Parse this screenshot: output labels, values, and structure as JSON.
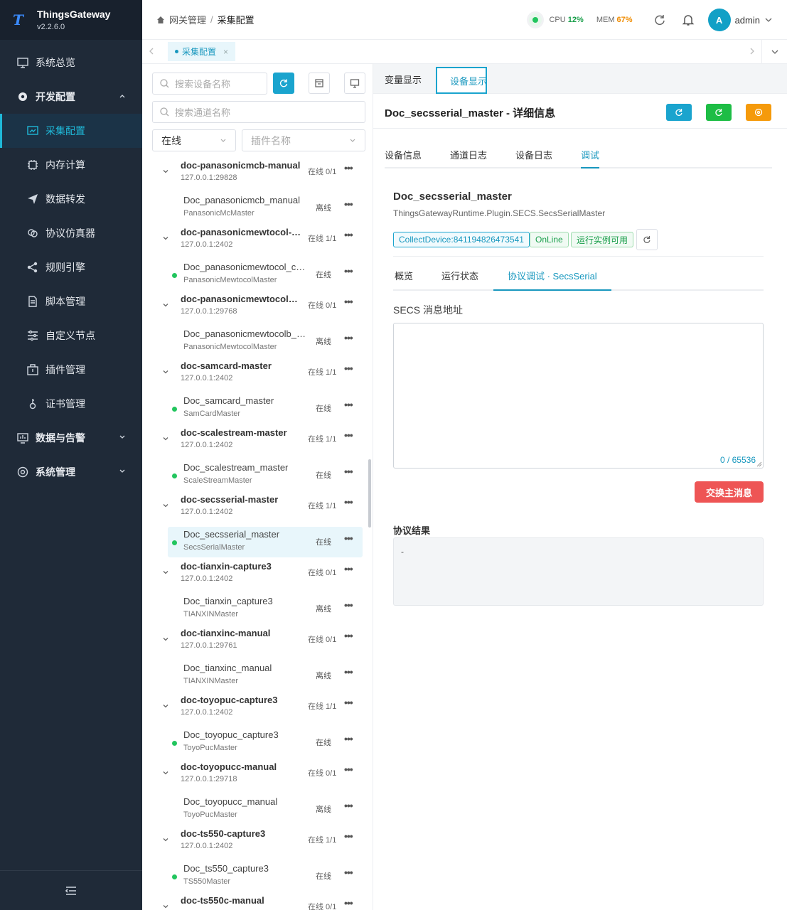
{
  "app": {
    "name": "ThingsGateway",
    "version": "v2.2.6.0"
  },
  "sidebar": {
    "items": [
      {
        "label": "系统总览"
      },
      {
        "label": "开发配置"
      },
      {
        "label": "采集配置"
      },
      {
        "label": "内存计算"
      },
      {
        "label": "数据转发"
      },
      {
        "label": "协议仿真器"
      },
      {
        "label": "规则引擎"
      },
      {
        "label": "脚本管理"
      },
      {
        "label": "自定义节点"
      },
      {
        "label": "插件管理"
      },
      {
        "label": "证书管理"
      },
      {
        "label": "数据与告警"
      },
      {
        "label": "系统管理"
      }
    ]
  },
  "header": {
    "breadcrumb": [
      "网关管理",
      "采集配置"
    ],
    "cpu_label": "CPU",
    "cpu_value": "12%",
    "mem_label": "MEM",
    "mem_value": "67%",
    "avatar_letter": "A",
    "user": "admin"
  },
  "page_tab": {
    "label": "采集配置",
    "close": "×"
  },
  "left": {
    "search_device_placeholder": "搜索设备名称",
    "search_channel_placeholder": "搜索通道名称",
    "status_select": "在线",
    "plugin_select": "插件名称",
    "tree": [
      {
        "channel": "doc-panasonicmcb-manual",
        "addr": "127.0.0.1:29828",
        "ch_status": "在线 0/1",
        "device": "Doc_panasonicmcb_manual",
        "plugin": "PanasonicMcMaster",
        "dev_status": "离线",
        "online": false
      },
      {
        "channel": "doc-panasonicmewtocol-c...",
        "addr": "127.0.0.1:2402",
        "ch_status": "在线 1/1",
        "device": "Doc_panasonicmewtocol_cap...",
        "plugin": "PanasonicMewtocolMaster",
        "dev_status": "在线",
        "online": true
      },
      {
        "channel": "doc-panasonicmewtocolb-...",
        "addr": "127.0.0.1:29768",
        "ch_status": "在线 0/1",
        "device": "Doc_panasonicmewtocolb_m...",
        "plugin": "PanasonicMewtocolMaster",
        "dev_status": "离线",
        "online": false
      },
      {
        "channel": "doc-samcard-master",
        "addr": "127.0.0.1:2402",
        "ch_status": "在线 1/1",
        "device": "Doc_samcard_master",
        "plugin": "SamCardMaster",
        "dev_status": "在线",
        "online": true
      },
      {
        "channel": "doc-scalestream-master",
        "addr": "127.0.0.1:2402",
        "ch_status": "在线 1/1",
        "device": "Doc_scalestream_master",
        "plugin": "ScaleStreamMaster",
        "dev_status": "在线",
        "online": true
      },
      {
        "channel": "doc-secsserial-master",
        "addr": "127.0.0.1:2402",
        "ch_status": "在线 1/1",
        "device": "Doc_secsserial_master",
        "plugin": "SecsSerialMaster",
        "dev_status": "在线",
        "online": true,
        "selected": true
      },
      {
        "channel": "doc-tianxin-capture3",
        "addr": "127.0.0.1:2402",
        "ch_status": "在线 0/1",
        "device": "Doc_tianxin_capture3",
        "plugin": "TIANXINMaster",
        "dev_status": "离线",
        "online": false
      },
      {
        "channel": "doc-tianxinc-manual",
        "addr": "127.0.0.1:29761",
        "ch_status": "在线 0/1",
        "device": "Doc_tianxinc_manual",
        "plugin": "TIANXINMaster",
        "dev_status": "离线",
        "online": false
      },
      {
        "channel": "doc-toyopuc-capture3",
        "addr": "127.0.0.1:2402",
        "ch_status": "在线 1/1",
        "device": "Doc_toyopuc_capture3",
        "plugin": "ToyoPucMaster",
        "dev_status": "在线",
        "online": true
      },
      {
        "channel": "doc-toyopucc-manual",
        "addr": "127.0.0.1:29718",
        "ch_status": "在线 0/1",
        "device": "Doc_toyopucc_manual",
        "plugin": "ToyoPucMaster",
        "dev_status": "离线",
        "online": false
      },
      {
        "channel": "doc-ts550-capture3",
        "addr": "127.0.0.1:2402",
        "ch_status": "在线 1/1",
        "device": "Doc_ts550_capture3",
        "plugin": "TS550Master",
        "dev_status": "在线",
        "online": true
      },
      {
        "channel": "doc-ts550c-manual",
        "addr": "",
        "ch_status": "在线 0/1"
      }
    ]
  },
  "right": {
    "view_tabs": [
      "变量显示",
      "设备显示"
    ],
    "title": "Doc_secsserial_master - 详细信息",
    "sub_tabs": [
      "设备信息",
      "通道日志",
      "设备日志",
      "调试"
    ],
    "device_name": "Doc_secsserial_master",
    "device_path": "ThingsGatewayRuntime.Plugin.SECS.SecsSerialMaster",
    "tags": [
      "CollectDevice:841194826473541",
      "OnLine",
      "运行实例可用"
    ],
    "inner_tabs": [
      "概览",
      "运行状态",
      "协议调试 · SecsSerial"
    ],
    "message_label": "SECS 消息地址",
    "counter": "0 / 65536",
    "send_button": "交换主消息",
    "result_label": "协议结果",
    "result_value": "-"
  },
  "colors": {
    "accent": "#1aa4ce",
    "green": "#22c55e",
    "orange": "#f59e0b",
    "danger": "#ee5555",
    "sidebar_bg": "#1f2a38"
  }
}
